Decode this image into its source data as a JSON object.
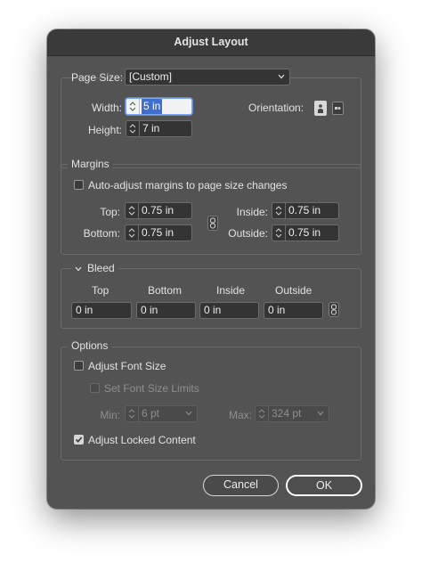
{
  "dialog": {
    "title": "Adjust Layout"
  },
  "page": {
    "size_label": "Page Size:",
    "size_value": "[Custom]",
    "width_label": "Width:",
    "width_value": "5 in",
    "height_label": "Height:",
    "height_value": "7 in",
    "orientation_label": "Orientation:"
  },
  "margins": {
    "heading": "Margins",
    "auto_adjust_label": "Auto-adjust margins to page size changes",
    "auto_adjust_checked": false,
    "top_label": "Top:",
    "top_value": "0.75 in",
    "bottom_label": "Bottom:",
    "bottom_value": "0.75 in",
    "inside_label": "Inside:",
    "inside_value": "0.75 in",
    "outside_label": "Outside:",
    "outside_value": "0.75 in"
  },
  "bleed": {
    "heading": "Bleed",
    "columns": [
      "Top",
      "Bottom",
      "Inside",
      "Outside"
    ],
    "values": [
      "0 in",
      "0 in",
      "0 in",
      "0 in"
    ]
  },
  "options": {
    "heading": "Options",
    "adjust_font_size_label": "Adjust Font Size",
    "adjust_font_size_checked": false,
    "set_limits_label": "Set Font Size Limits",
    "set_limits_checked": false,
    "min_label": "Min:",
    "min_value": "6 pt",
    "max_label": "Max:",
    "max_value": "324 pt",
    "adjust_locked_label": "Adjust Locked Content",
    "adjust_locked_checked": true
  },
  "buttons": {
    "cancel": "Cancel",
    "ok": "OK"
  },
  "icons": {
    "spinner": "spinner-arrows-icon",
    "chain": "chain-link-icon",
    "portrait": "portrait-orientation-icon",
    "landscape": "landscape-orientation-icon",
    "chevron": "chevron-down-icon",
    "check": "checkmark-icon"
  }
}
